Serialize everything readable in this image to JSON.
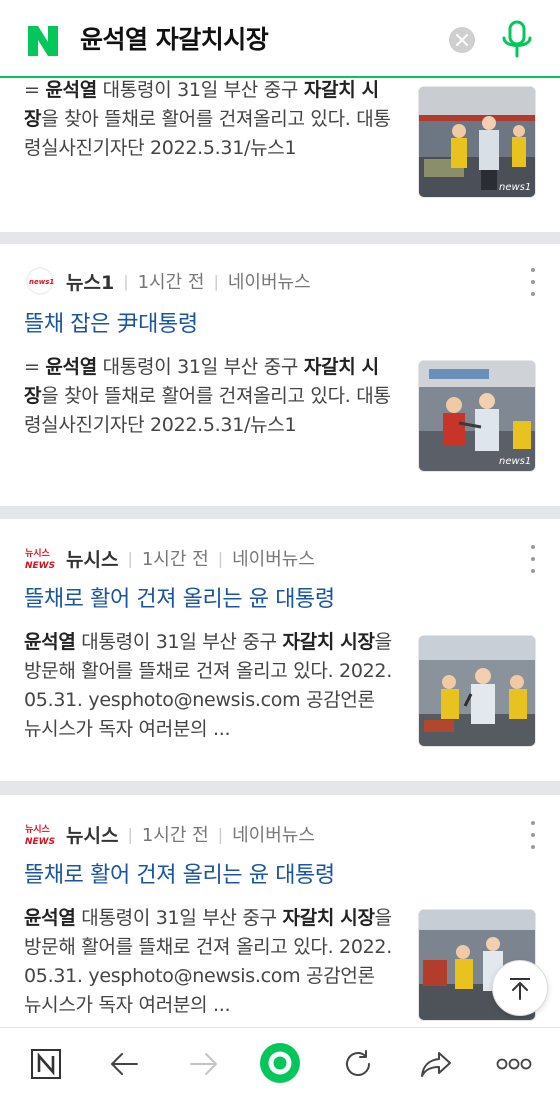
{
  "search": {
    "query": "윤석열 자갈치시장",
    "logo_letter": "N"
  },
  "articles": [
    {
      "source": "",
      "time": "",
      "platform": "",
      "title": "",
      "body_parts": [
        {
          "text": "= ",
          "bold": false
        },
        {
          "text": "윤석열",
          "bold": true
        },
        {
          "text": " 대통령이 31일 부산 중구 ",
          "bold": false
        },
        {
          "text": "자갈치 시장",
          "bold": true
        },
        {
          "text": "을 찾아 뜰채로 활어를 건져올리고 있다. 대통령실사진기자단 2022.5.31/뉴스1",
          "bold": false
        }
      ],
      "thumb_badge": "news1"
    },
    {
      "source": "뉴스1",
      "time": "1시간 전",
      "platform": "네이버뉴스",
      "title": "뜰채 잡은 尹대통령",
      "body_parts": [
        {
          "text": "= ",
          "bold": false
        },
        {
          "text": "윤석열",
          "bold": true
        },
        {
          "text": " 대통령이 31일 부산 중구 ",
          "bold": false
        },
        {
          "text": "자갈치 시장",
          "bold": true
        },
        {
          "text": "을 찾아 뜰채로 활어를 건져올리고 있다. 대통령실사진기자단 2022.5.31/뉴스1",
          "bold": false
        }
      ],
      "thumb_badge": "news1",
      "logo_text": "news1"
    },
    {
      "source": "뉴시스",
      "time": "1시간 전",
      "platform": "네이버뉴스",
      "title": "뜰채로 활어 건져 올리는 윤 대통령",
      "body_parts": [
        {
          "text": "윤석열",
          "bold": true
        },
        {
          "text": " 대통령이 31일 부산 중구 ",
          "bold": false
        },
        {
          "text": "자갈치 시장",
          "bold": true
        },
        {
          "text": "을 방문해 활어를 뜰채로 건져 올리고 있다. 2022.05.31. yesphoto@newsis.com 공감언론 뉴시스가 독자 여러분의 ...",
          "bold": false
        }
      ],
      "thumb_badge": "",
      "logo_text": "뉴시스 NEWS"
    },
    {
      "source": "뉴시스",
      "time": "1시간 전",
      "platform": "네이버뉴스",
      "title": "뜰채로 활어 건져 올리는 윤 대통령",
      "body_parts": [
        {
          "text": "윤석열",
          "bold": true
        },
        {
          "text": " 대통령이 31일 부산 중구 ",
          "bold": false
        },
        {
          "text": "자갈치 시장",
          "bold": true
        },
        {
          "text": "을 방문해 활어를 뜰채로 건져 올리고 있다. 2022.05.31. yesphoto@newsis.com 공감언론 뉴시스가 독자 여러분의 ...",
          "bold": false
        }
      ],
      "thumb_badge": "",
      "logo_text": "뉴시스 NEWS"
    }
  ],
  "bottom_nav": {
    "home_letter": "N",
    "icons": [
      "naver-home-icon",
      "back-arrow-icon",
      "forward-arrow-icon",
      "green-dot-icon",
      "refresh-icon",
      "share-icon",
      "more-dots-icon"
    ]
  },
  "colors": {
    "naver_green": "#03c75a",
    "title_blue": "#1a55a3",
    "separator_gray": "#e4e6e9",
    "newsis_red": "#d7131d"
  }
}
